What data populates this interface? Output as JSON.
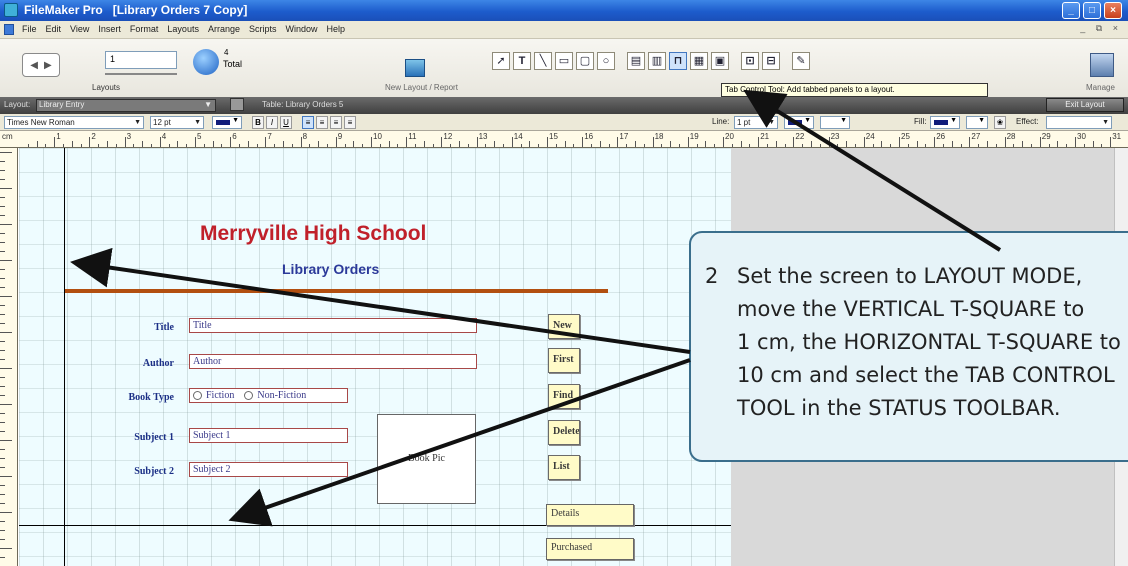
{
  "window": {
    "app_name": "FileMaker Pro",
    "document_title": "[Library Orders 7 Copy]"
  },
  "menu": [
    "File",
    "Edit",
    "View",
    "Insert",
    "Format",
    "Layouts",
    "Arrange",
    "Scripts",
    "Window",
    "Help"
  ],
  "status_toolbar": {
    "record_number": "1",
    "total_count": "4",
    "total_label": "Total",
    "layouts_label": "Layouts",
    "new_layout_label": "New Layout / Report",
    "manage_label": "Manage",
    "tooltip": "Tab Control Tool: Add tabbed panels to a layout."
  },
  "layout_bar": {
    "layout_label": "Layout:",
    "layout_value": "Library Entry",
    "table_label": "Table: Library Orders 5",
    "exit_label": "Exit Layout"
  },
  "format_bar": {
    "font": "Times New Roman",
    "size": "12 pt",
    "bold": "B",
    "italic": "I",
    "underline": "U",
    "line_label": "Line:",
    "line_value": "1 pt",
    "fill_label": "Fill:",
    "effect_label": "Effect:"
  },
  "ruler": {
    "unit": "cm",
    "labels": [
      "1",
      "2",
      "3",
      "4",
      "5",
      "6",
      "7",
      "8",
      "9",
      "10",
      "11",
      "12",
      "13",
      "14",
      "15",
      "16",
      "17",
      "18",
      "19",
      "20",
      "21",
      "22",
      "23",
      "24",
      "25",
      "26",
      "27",
      "28",
      "29",
      "30",
      "31"
    ]
  },
  "layout": {
    "school_title": "Merryville High School",
    "subtitle": "Library Orders",
    "title_label": "Title",
    "title_value": "Title",
    "author_label": "Author",
    "author_value": "Author",
    "booktype_label": "Book Type",
    "fiction": "Fiction",
    "nonfiction": "Non-Fiction",
    "subject1_label": "Subject 1",
    "subject1_value": "Subject 1",
    "subject2_label": "Subject 2",
    "subject2_value": "Subject 2",
    "pic_label": "Book Pic",
    "buttons": [
      "New",
      "First",
      "Find",
      "Delete",
      "List"
    ],
    "tab_buttons": [
      "Details",
      "Purchased"
    ]
  },
  "callout": {
    "number": "2",
    "lines": [
      "Set the screen to LAYOUT MODE,",
      "move the VERTICAL T-SQUARE to",
      "1 cm, the HORIZONTAL T-SQUARE to",
      "10 cm and select the TAB CONTROL",
      "TOOL in the STATUS TOOLBAR."
    ]
  },
  "colors": {
    "school_title": "#c0202a",
    "subtitle": "#2c3a9a",
    "callout_bg": "#e6f3f8",
    "header_line": "#b24f10"
  }
}
